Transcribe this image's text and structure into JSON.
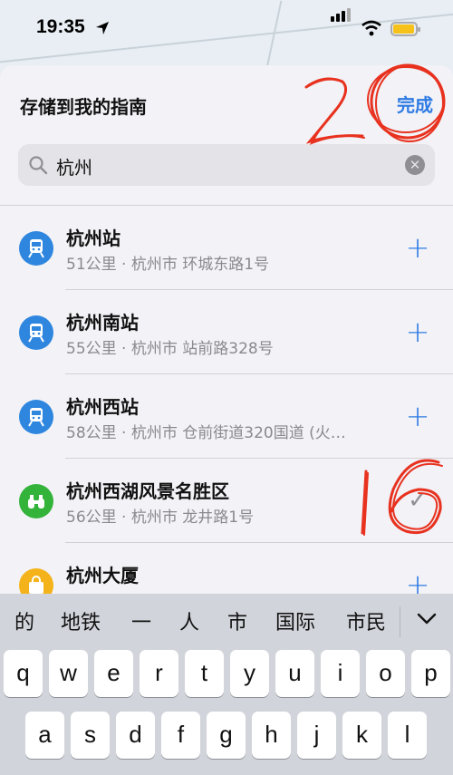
{
  "status_bar": {
    "time": "19:35"
  },
  "sheet": {
    "title": "存储到我的指南",
    "done_label": "完成"
  },
  "search": {
    "query": "杭州"
  },
  "results": [
    {
      "name": "杭州站",
      "detail": "51公里 · 杭州市 环城东路1号",
      "icon": "train-icon",
      "color": "#2e86de",
      "action": "add"
    },
    {
      "name": "杭州南站",
      "detail": "55公里 · 杭州市 站前路328号",
      "icon": "train-icon",
      "color": "#2e86de",
      "action": "add"
    },
    {
      "name": "杭州西站",
      "detail": "58公里 · 杭州市 仓前街道320国道 (火…",
      "icon": "train-icon",
      "color": "#2e86de",
      "action": "add"
    },
    {
      "name": "杭州西湖风景名胜区",
      "detail": "56公里 · 杭州市 龙井路1号",
      "icon": "binoculars-icon",
      "color": "#34b33a",
      "action": "added"
    },
    {
      "name": "杭州大厦",
      "detail": "",
      "icon": "shopping-bag-icon",
      "color": "#f4b31a",
      "action": "add"
    }
  ],
  "keyboard": {
    "candidates": [
      "的",
      "地铁",
      "一",
      "人",
      "市",
      "国际",
      "市民"
    ],
    "row1": [
      "q",
      "w",
      "e",
      "r",
      "t",
      "y",
      "u",
      "i",
      "o",
      "p"
    ],
    "row2": [
      "a",
      "s",
      "d",
      "f",
      "g",
      "h",
      "j",
      "k",
      "l"
    ]
  },
  "annotations": {
    "top_mark": "20",
    "row_mark": "16",
    "mark_color": "#e8321f"
  }
}
